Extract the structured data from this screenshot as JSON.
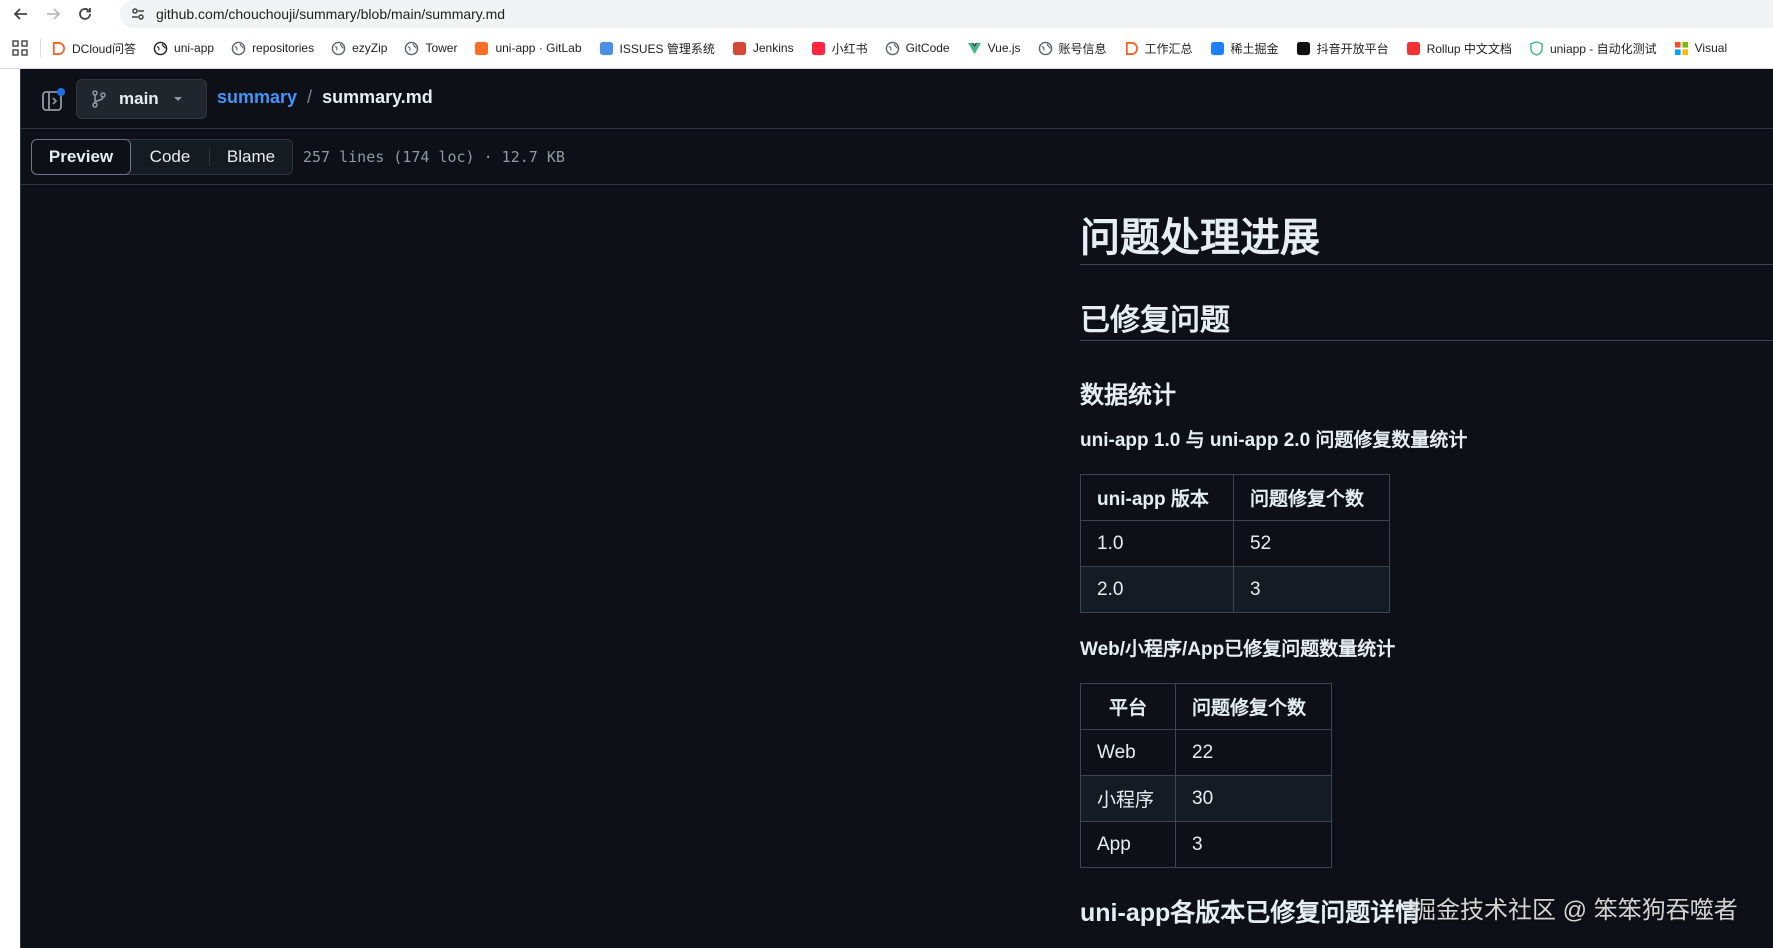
{
  "browser": {
    "url": "github.com/chouchouji/summary/blob/main/summary.md"
  },
  "bookmarks": [
    {
      "label": "DCloud问答",
      "icon": "dcloud-icon",
      "color": "#ff5a1f"
    },
    {
      "label": "uni-app",
      "icon": "github-icon",
      "color": "#1f1f1f"
    },
    {
      "label": "repositories",
      "icon": "globe-icon",
      "color": "#5f6368"
    },
    {
      "label": "ezyZip",
      "icon": "globe-icon",
      "color": "#5f6368"
    },
    {
      "label": "Tower",
      "icon": "globe-icon",
      "color": "#5f6368"
    },
    {
      "label": "uni-app · GitLab",
      "icon": "gitlab-icon",
      "color": "#fc6d26"
    },
    {
      "label": "ISSUES 管理系统",
      "icon": "gear-icon",
      "color": "#4a90e2"
    },
    {
      "label": "Jenkins",
      "icon": "jenkins-icon",
      "color": "#d24939"
    },
    {
      "label": "小红书",
      "icon": "xiaohongshu-icon",
      "color": "#ff2442"
    },
    {
      "label": "GitCode",
      "icon": "globe-icon",
      "color": "#5f6368"
    },
    {
      "label": "Vue.js",
      "icon": "vue-icon",
      "color": "#42b883"
    },
    {
      "label": "账号信息",
      "icon": "globe-icon",
      "color": "#5f6368"
    },
    {
      "label": "工作汇总",
      "icon": "dcloud-icon",
      "color": "#ff5a1f"
    },
    {
      "label": "稀土掘金",
      "icon": "juejin-icon",
      "color": "#1e80ff"
    },
    {
      "label": "抖音开放平台",
      "icon": "douyin-icon",
      "color": "#111111"
    },
    {
      "label": "Rollup 中文文档",
      "icon": "rollup-icon",
      "color": "#ef3335"
    },
    {
      "label": "uniapp - 自动化测试",
      "icon": "shield-icon",
      "color": "#2bb673"
    },
    {
      "label": "Visual",
      "icon": "microsoft-icon",
      "color": "#f25022"
    }
  ],
  "repo": {
    "branch": "main",
    "repo_name": "summary",
    "separator": "/",
    "file_name": "summary.md"
  },
  "file_toolbar": {
    "tabs": [
      "Preview",
      "Code",
      "Blame"
    ],
    "active_tab": "Preview",
    "meta": "257 lines (174 loc) · 12.7 KB"
  },
  "markdown": {
    "h1": "问题处理进展",
    "h2": "已修复问题",
    "h3": "数据统计",
    "section1_title": "uni-app 1.0 与 uni-app 2.0 问题修复数量统计",
    "table1": {
      "headers": [
        "uni-app 版本",
        "问题修复个数"
      ],
      "rows": [
        [
          "1.0",
          "52"
        ],
        [
          "2.0",
          "3"
        ]
      ]
    },
    "section2_title": "Web/小程序/App已修复问题数量统计",
    "table2": {
      "headers": [
        "平台",
        "问题修复个数"
      ],
      "rows": [
        [
          "Web",
          "22"
        ],
        [
          "小程序",
          "30"
        ],
        [
          "App",
          "3"
        ]
      ]
    },
    "h2b": "uni-app各版本已修复问题详情"
  },
  "watermark": "掘金技术社区 @ 笨笨狗吞噬者",
  "colors": {
    "link": "#4493f8",
    "bg": "#0d1117",
    "border": "#30363d",
    "text": "#e6edf3"
  }
}
